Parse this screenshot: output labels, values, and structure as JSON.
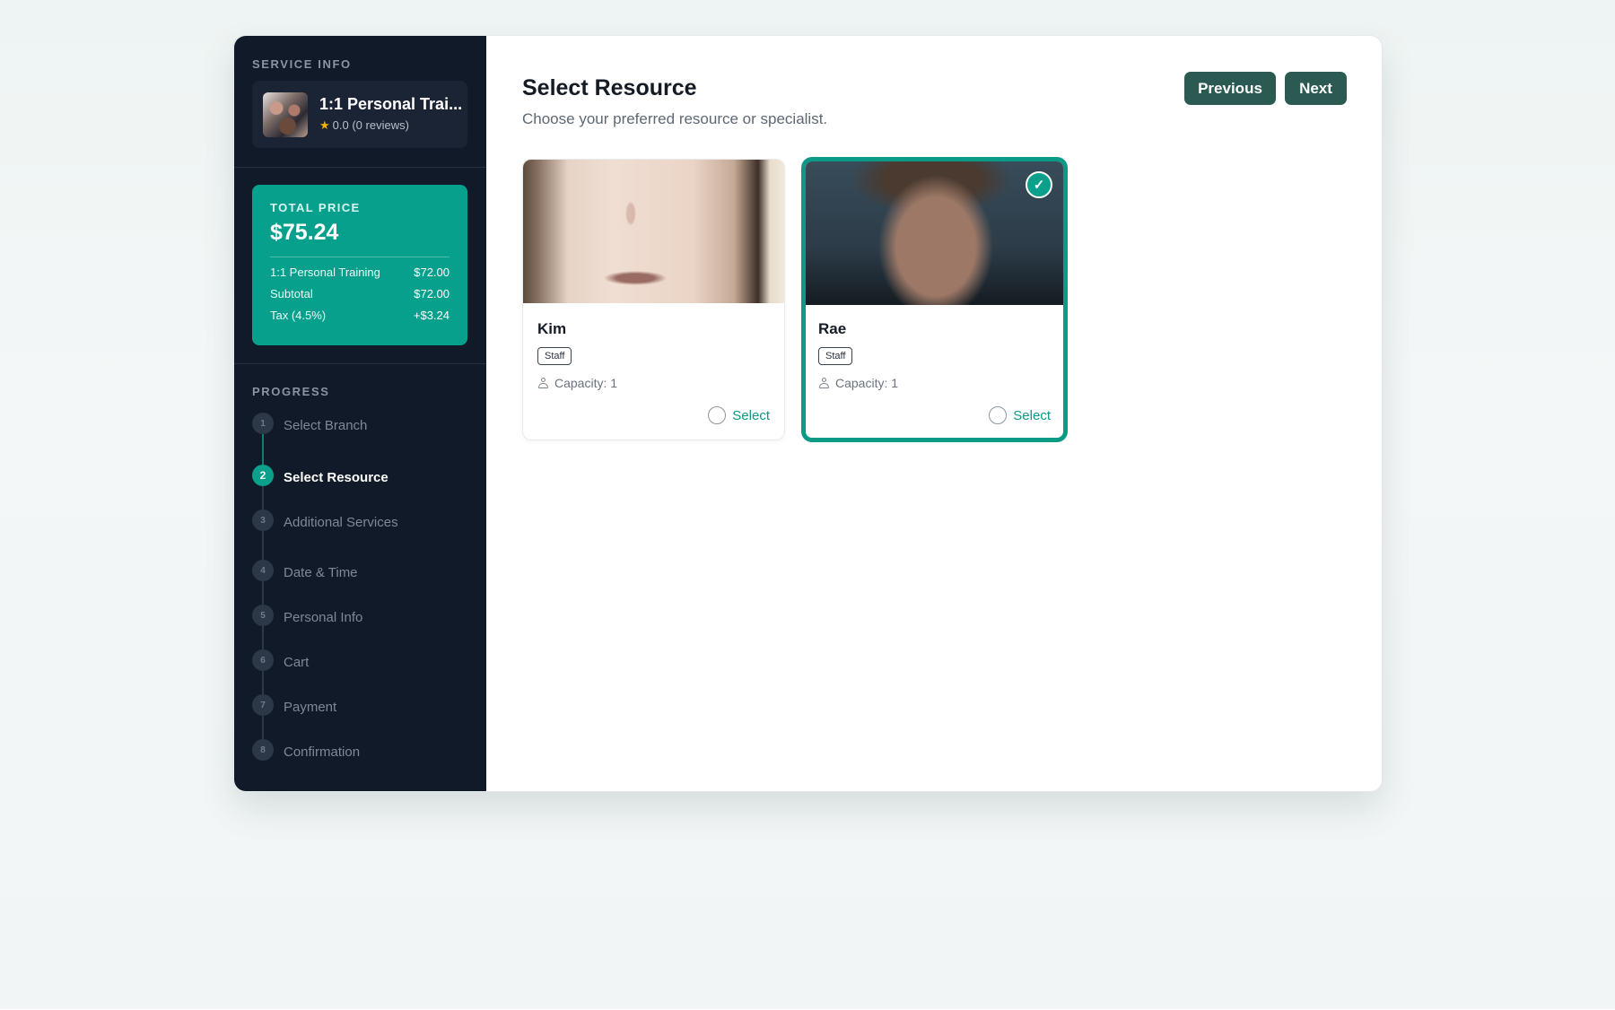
{
  "sidebar": {
    "service_info_label": "SERVICE INFO",
    "service": {
      "name": "1:1 Personal Trai...",
      "rating": "0.0 (0 reviews)",
      "star_icon": "star-icon"
    },
    "price": {
      "label": "TOTAL PRICE",
      "total": "$75.24",
      "rows": [
        {
          "label": "1:1 Personal Training",
          "value": "$72.00"
        },
        {
          "label": "Subtotal",
          "value": "$72.00"
        },
        {
          "label": "Tax (4.5%)",
          "value": "+$3.24"
        }
      ]
    },
    "progress_label": "PROGRESS",
    "steps": [
      {
        "num": "1",
        "label": "Select Branch",
        "state": "done"
      },
      {
        "num": "2",
        "label": "Select Resource",
        "state": "active"
      },
      {
        "num": "3",
        "label": "Additional Services",
        "state": "pending"
      },
      {
        "num": "4",
        "label": "Date & Time",
        "state": "pending"
      },
      {
        "num": "5",
        "label": "Personal Info",
        "state": "pending"
      },
      {
        "num": "6",
        "label": "Cart",
        "state": "pending"
      },
      {
        "num": "7",
        "label": "Payment",
        "state": "pending"
      },
      {
        "num": "8",
        "label": "Confirmation",
        "state": "pending"
      }
    ]
  },
  "main": {
    "title": "Select Resource",
    "subtitle": "Choose your preferred resource or specialist.",
    "previous_label": "Previous",
    "next_label": "Next",
    "resources": [
      {
        "name": "Kim",
        "tag": "Staff",
        "capacity": "Capacity: 1",
        "select_label": "Select",
        "selected": false
      },
      {
        "name": "Rae",
        "tag": "Staff",
        "capacity": "Capacity: 1",
        "select_label": "Select",
        "selected": true
      }
    ]
  },
  "colors": {
    "sidebar_bg": "#111a28",
    "accent": "#0aa08b",
    "button_bg": "#2a5a52"
  }
}
